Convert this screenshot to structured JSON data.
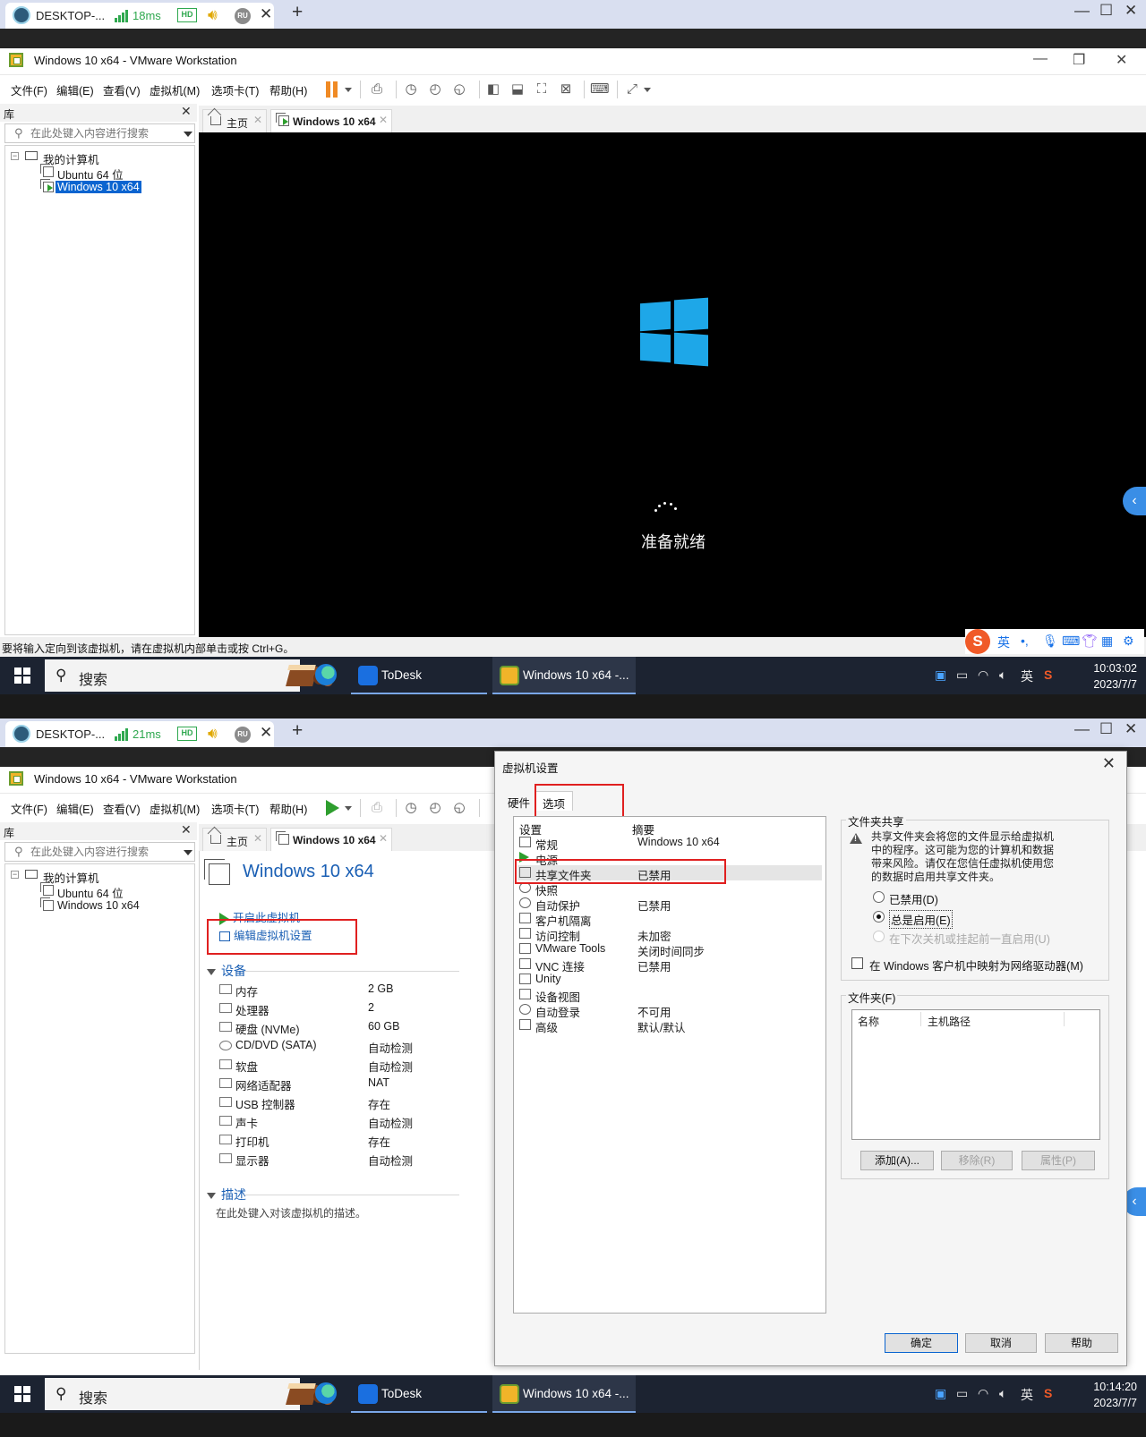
{
  "remote": {
    "desktop_name": "DESKTOP-...",
    "ping_1": "18ms",
    "ping_2": "21ms",
    "hd": "HD",
    "ru": "RU"
  },
  "window": {
    "title": "Windows 10 x64 - VMware Workstation"
  },
  "menu": [
    "文件(F)",
    "编辑(E)",
    "查看(V)",
    "虚拟机(M)",
    "选项卡(T)",
    "帮助(H)"
  ],
  "library": {
    "title": "库",
    "search_placeholder": "在此处键入内容进行搜索",
    "root": "我的计算机",
    "vms": [
      "Ubuntu 64 位",
      "Windows 10 x64"
    ]
  },
  "tabs": {
    "home": "主页",
    "vm": "Windows 10 x64"
  },
  "boot": {
    "text": "准备就绪"
  },
  "statusbar": {
    "hint": "要将输入定向到该虚拟机，请在虚拟机内部单击或按 Ctrl+G。"
  },
  "ime": {
    "s": "S",
    "lang": "英",
    "punct": "•,"
  },
  "taskbar": {
    "search": "搜索",
    "apps": [
      "ToDesk",
      "Windows 10 x64 -..."
    ],
    "lang": "英",
    "time_1": "10:03:02",
    "date_1": "2023/7/7",
    "time_2": "10:14:20",
    "date_2": "2023/7/7"
  },
  "summary": {
    "title": "Windows 10 x64",
    "power_on": "开启此虚拟机",
    "edit_settings": "编辑虚拟机设置",
    "devices_heading": "设备",
    "devices": [
      {
        "name": "内存",
        "value": "2 GB"
      },
      {
        "name": "处理器",
        "value": "2"
      },
      {
        "name": "硬盘 (NVMe)",
        "value": "60 GB"
      },
      {
        "name": "CD/DVD (SATA)",
        "value": "自动检测"
      },
      {
        "name": "软盘",
        "value": "自动检测"
      },
      {
        "name": "网络适配器",
        "value": "NAT"
      },
      {
        "name": "USB 控制器",
        "value": "存在"
      },
      {
        "name": "声卡",
        "value": "自动检测"
      },
      {
        "name": "打印机",
        "value": "存在"
      },
      {
        "name": "显示器",
        "value": "自动检测"
      }
    ],
    "desc_heading": "描述",
    "desc_hint": "在此处键入对该虚拟机的描述。"
  },
  "dialog": {
    "title": "虚拟机设置",
    "tab_hardware": "硬件",
    "tab_options": "选项",
    "col_setting": "设置",
    "col_summary": "摘要",
    "options": [
      {
        "name": "常规",
        "value": "Windows 10 x64"
      },
      {
        "name": "电源",
        "value": ""
      },
      {
        "name": "共享文件夹",
        "value": "已禁用"
      },
      {
        "name": "快照",
        "value": ""
      },
      {
        "name": "自动保护",
        "value": "已禁用"
      },
      {
        "name": "客户机隔离",
        "value": ""
      },
      {
        "name": "访问控制",
        "value": "未加密"
      },
      {
        "name": "VMware Tools",
        "value": "关闭时间同步"
      },
      {
        "name": "VNC 连接",
        "value": "已禁用"
      },
      {
        "name": "Unity",
        "value": ""
      },
      {
        "name": "设备视图",
        "value": ""
      },
      {
        "name": "自动登录",
        "value": "不可用"
      },
      {
        "name": "高级",
        "value": "默认/默认"
      }
    ],
    "share_group": "文件夹共享",
    "warning": [
      "共享文件夹会将您的文件显示给虚拟机",
      "中的程序。这可能为您的计算机和数据",
      "带来风险。请仅在您信任虚拟机使用您",
      "的数据时启用共享文件夹。"
    ],
    "radio_disabled": "已禁用(D)",
    "radio_always": "总是启用(E)",
    "radio_next": "在下次关机或挂起前一直启用(U)",
    "map_drive": "在 Windows 客户机中映射为网络驱动器(M)",
    "folder_group": "文件夹(F)",
    "col_name": "名称",
    "col_path": "主机路径",
    "btn_add": "添加(A)...",
    "btn_remove": "移除(R)",
    "btn_props": "属性(P)",
    "btn_ok": "确定",
    "btn_cancel": "取消",
    "btn_help": "帮助"
  }
}
